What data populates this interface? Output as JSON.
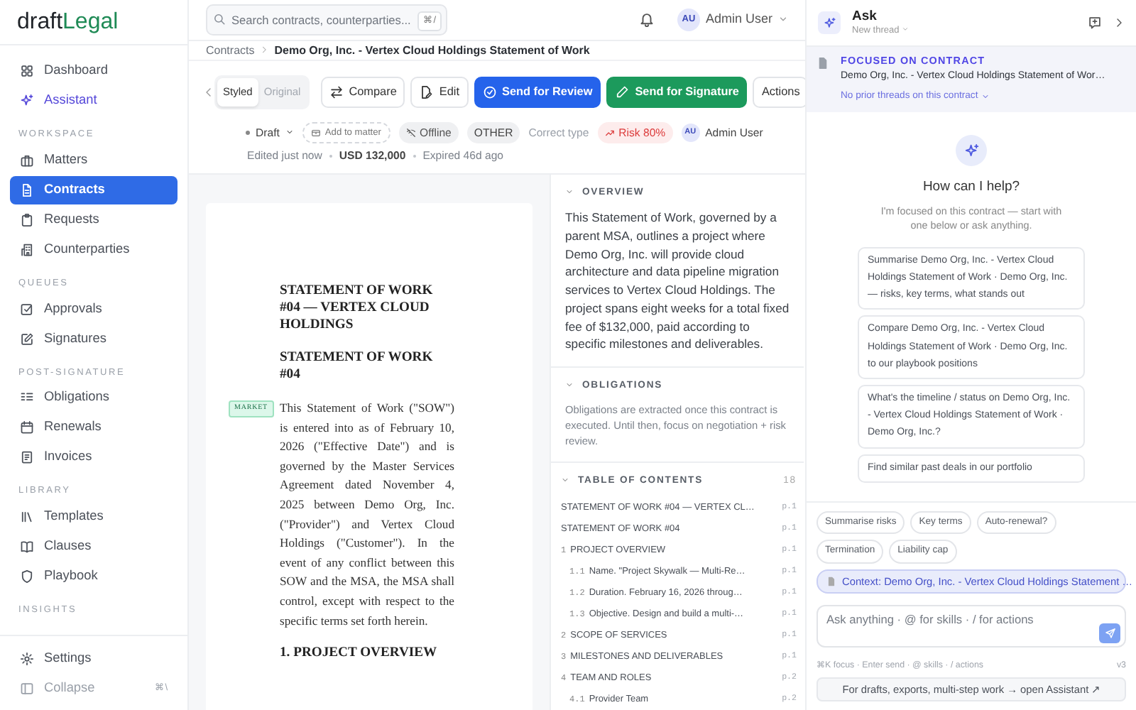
{
  "brand": {
    "parts": [
      "draft",
      "Legal"
    ]
  },
  "sidebar": {
    "groups": [
      {
        "items": [
          {
            "label": "Dashboard",
            "kind": "link",
            "selected": false
          },
          {
            "label": "Assistant",
            "kind": "ai",
            "selected": false
          }
        ]
      },
      {
        "heading": "WORKSPACE",
        "items": [
          {
            "label": "Matters",
            "kind": "link",
            "selected": false
          },
          {
            "label": "Contracts",
            "kind": "link",
            "selected": true
          },
          {
            "label": "Requests",
            "kind": "link",
            "selected": false
          },
          {
            "label": "Counterparties",
            "kind": "link",
            "selected": false
          }
        ]
      },
      {
        "heading": "QUEUES",
        "items": [
          {
            "label": "Approvals",
            "kind": "link",
            "selected": false
          },
          {
            "label": "Signatures",
            "kind": "link",
            "selected": false
          }
        ]
      },
      {
        "heading": "POST-SIGNATURE",
        "items": [
          {
            "label": "Obligations",
            "kind": "link",
            "selected": false
          },
          {
            "label": "Renewals",
            "kind": "link",
            "selected": false
          },
          {
            "label": "Invoices",
            "kind": "link",
            "selected": false
          }
        ]
      },
      {
        "heading": "LIBRARY",
        "items": [
          {
            "label": "Templates",
            "kind": "link",
            "selected": false
          },
          {
            "label": "Clauses",
            "kind": "link",
            "selected": false
          },
          {
            "label": "Playbook",
            "kind": "link",
            "selected": false
          }
        ]
      },
      {
        "heading": "INSIGHTS"
      }
    ],
    "footer": [
      {
        "label": "Settings",
        "kind": "link"
      },
      {
        "label": "Collapse",
        "kind": "toggle",
        "shortcut": "⌘\\"
      }
    ]
  },
  "topbar": {
    "search": {
      "placeholder": "Search contracts, counterparties...",
      "shortcut": "⌘/"
    },
    "user": {
      "initials": "AU",
      "name": "Admin User"
    }
  },
  "breadcrumb": [
    "Contracts",
    "Demo Org, Inc. - Vertex Cloud Holdings Statement of Work"
  ],
  "toolbar": {
    "view_toggle": [
      {
        "label": "Styled",
        "selected": true
      },
      {
        "label": "Original",
        "selected": false
      }
    ],
    "buttons": [
      {
        "label": "Compare",
        "kind": "outline"
      },
      {
        "label": "Edit",
        "kind": "outline"
      },
      {
        "label": "Send for Review",
        "kind": "primary"
      },
      {
        "label": "Send for Signature",
        "kind": "success"
      },
      {
        "label": "Actions",
        "kind": "plain"
      }
    ]
  },
  "meta": {
    "status": "Draft",
    "add_to_matter": "Add to matter",
    "sync": "Offline",
    "type": "OTHER",
    "type_hint": "Correct type",
    "risk": "Risk 80%",
    "owner": {
      "initials": "AU",
      "name": "Admin User"
    },
    "details": [
      "Edited just now",
      "USD 132,000",
      "Expired 46d ago"
    ]
  },
  "document": {
    "blocks": [
      {
        "kind": "title",
        "text": "STATEMENT OF WORK #04 — VERTEX CLOUD HOLDINGS"
      },
      {
        "kind": "heading",
        "text": "STATEMENT OF WORK #04"
      },
      {
        "kind": "paragraph",
        "tag": "MARKET",
        "text": "This Statement of Work (\"SOW\") is entered into as of February 10, 2026 (\"Effective Date\") and is governed by the Master Services Agreement dated November 4, 2025 between Demo Org, Inc. (\"Provider\") and Vertex Cloud Holdings (\"Customer\"). In the event of any conflict between this SOW and the MSA, the MSA shall control, except with respect to the specific terms set forth herein."
      },
      {
        "kind": "heading",
        "text": "1. PROJECT OVERVIEW"
      }
    ]
  },
  "insights": {
    "overview": {
      "title": "OVERVIEW",
      "text": "This Statement of Work, governed by a parent MSA, outlines a project where Demo Org, Inc. will provide cloud architecture and data pipeline migration services to Vertex Cloud Holdings. The project spans eight weeks for a total fixed fee of $132,000, paid according to specific milestones and deliverables."
    },
    "obligations": {
      "title": "OBLIGATIONS",
      "text": "Obligations are extracted once this contract is executed. Until then, focus on negotiation + risk review."
    },
    "toc": {
      "title": "TABLE OF CONTENTS",
      "count": "18",
      "items": [
        {
          "title": "STATEMENT OF WORK #04 — VERTEX CL…",
          "page": "p.1"
        },
        {
          "title": "STATEMENT OF WORK #04",
          "page": "p.1"
        },
        {
          "number": "1",
          "title": "PROJECT OVERVIEW",
          "page": "p.1",
          "children": [
            {
              "number": "1.1",
              "title": "Name. \"Project Skywalk — Multi-Re…",
              "page": "p.1"
            },
            {
              "number": "1.2",
              "title": "Duration. February 16, 2026 throug…",
              "page": "p.1"
            },
            {
              "number": "1.3",
              "title": "Objective. Design and build a multi-…",
              "page": "p.1"
            }
          ]
        },
        {
          "number": "2",
          "title": "SCOPE OF SERVICES",
          "page": "p.1"
        },
        {
          "number": "3",
          "title": "MILESTONES AND DELIVERABLES",
          "page": "p.1"
        },
        {
          "number": "4",
          "title": "TEAM AND ROLES",
          "page": "p.2",
          "children": [
            {
              "number": "4.1",
              "title": "Provider Team",
              "page": "p.2"
            }
          ]
        }
      ]
    }
  },
  "assistant": {
    "title": "Ask",
    "thread": "New thread",
    "focus": {
      "label": "FOCUSED ON CONTRACT",
      "contract": "Demo Org, Inc. - Vertex Cloud Holdings Statement of Wor…",
      "threads": "No prior threads on this contract"
    },
    "empty": {
      "title": "How can I help?",
      "text": "I'm focused on this contract — start with one below or ask anything."
    },
    "suggestions": [
      "Summarise Demo Org, Inc. - Vertex Cloud Holdings Statement of Work · Demo Org, Inc. — risks, key terms, what stands out",
      "Compare Demo Org, Inc. - Vertex Cloud Holdings Statement of Work · Demo Org, Inc. to our playbook positions",
      "What's the timeline / status on Demo Org, Inc. - Vertex Cloud Holdings Statement of Work · Demo Org, Inc.?",
      "Find similar past deals in our portfolio"
    ],
    "chips": [
      "Summarise risks",
      "Key terms",
      "Auto-renewal?",
      "Termination",
      "Liability cap"
    ],
    "context": "Context: Demo Org, Inc. - Vertex Cloud Holdings Statement …",
    "input": {
      "placeholder": "Ask anything · @ for skills · / for actions"
    },
    "hint": "⌘K focus · Enter send · @ skills · / actions",
    "version": "v3",
    "open_button": "For drafts, exports, multi-step work → open Assistant ↗"
  }
}
